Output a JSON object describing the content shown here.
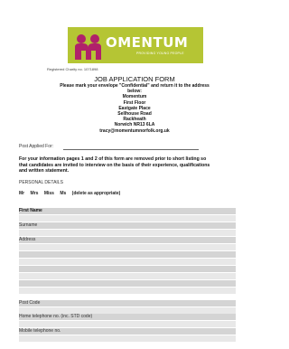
{
  "logo": {
    "name": "OMENTUM",
    "tagline": "PROVIDING YOUNG PEOPLE"
  },
  "charity": "Registered Charity no. 1071898",
  "form_title": "JOB APPLICATION FORM",
  "instructions": [
    "Please mark your envelope \"Confidential\" and return it to the address",
    "below:",
    "Momentum",
    "First Floor",
    "Eastgate Place",
    "Sellhouse Road",
    "Rackheath",
    "Norwich  NR13 6LA",
    "tracy@momentumnorfolk.org.uk"
  ],
  "post_applied_label": "Post Applied For:",
  "info_text": [
    "For your information pages 1 and 2 of this form are removed prior to short listing so",
    "that candidates are invited to interview on the basis of their experience, qualifications",
    "and written statement."
  ],
  "personal_details": "PERSONAL DETAILS",
  "titles": [
    "Mr",
    "Mrs",
    "Miss",
    "Ms",
    "(delete as appropriate)"
  ],
  "fields": {
    "first_name": "First Name",
    "surname": "Surname",
    "address": "Address",
    "post_code": "Post Code",
    "home_tel": "Home telephone no.  (inc. STD code)",
    "mobile_tel": "Mobile telephone no."
  },
  "colors": {
    "logo_green": "#b5c534",
    "logo_pink": "#b0216a"
  }
}
